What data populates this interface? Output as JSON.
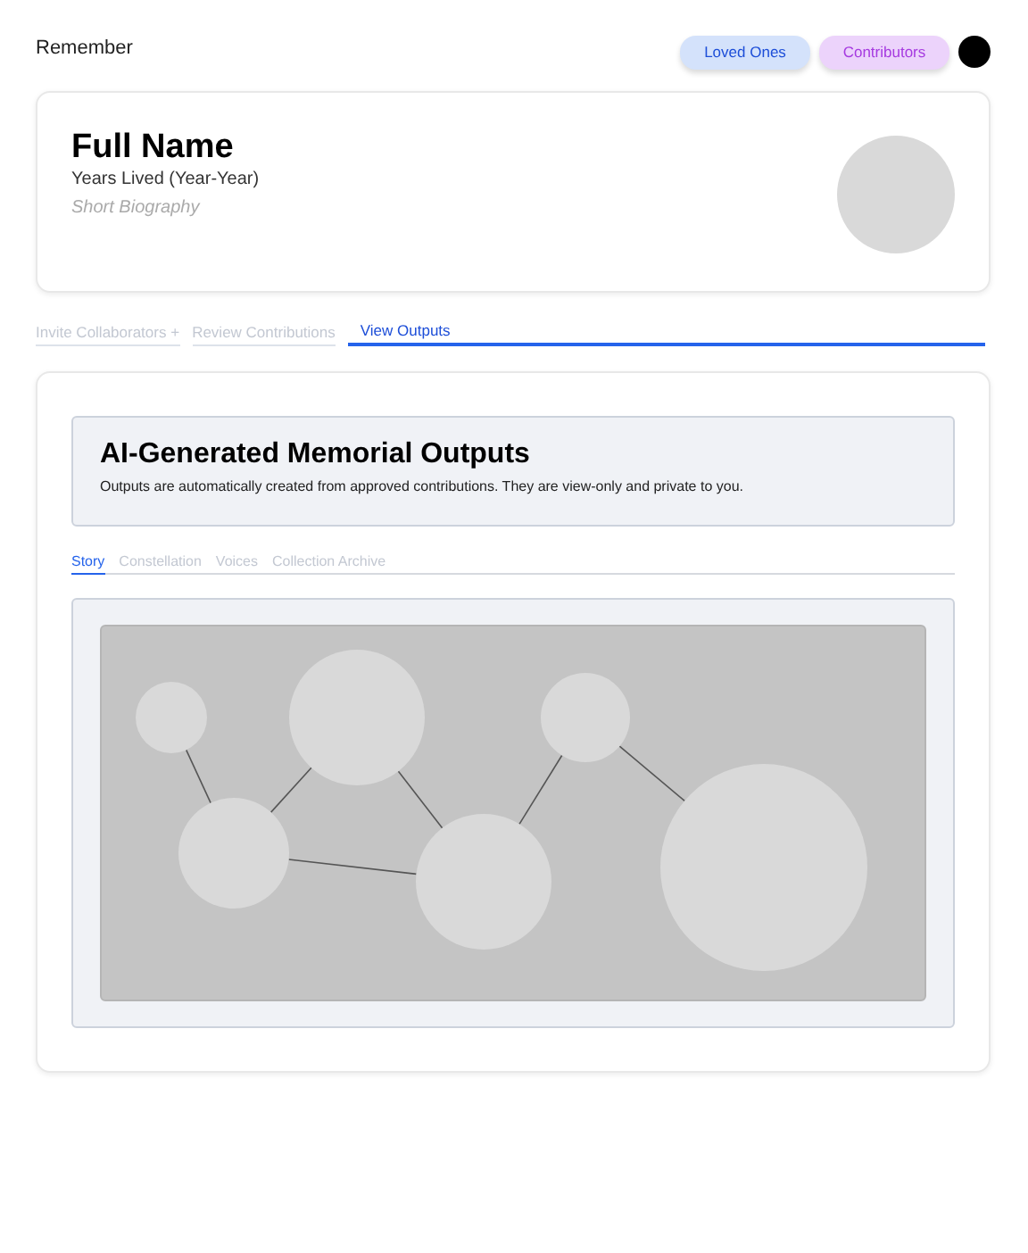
{
  "header": {
    "brand": "Remember",
    "buttons": [
      {
        "label": "Loved Ones",
        "kind": "blue"
      },
      {
        "label": "Contributors",
        "kind": "purple"
      }
    ]
  },
  "profile": {
    "name": "Full Name",
    "years": "Years Lived (Year-Year)",
    "bio": "Short Biography"
  },
  "tabs": [
    {
      "label": "Invite Collaborators +",
      "selected": false
    },
    {
      "label": "Review Contributions",
      "selected": false
    },
    {
      "label": "View Outputs",
      "selected": true
    }
  ],
  "outputs": {
    "title": "AI-Generated Memorial Outputs",
    "description": "Outputs are automatically created from approved contributions. They are view-only and private to you.",
    "tabs": [
      {
        "label": "Story",
        "selected": true
      },
      {
        "label": "Constellation",
        "selected": false
      },
      {
        "label": "Voices",
        "selected": false
      },
      {
        "label": "Collection Archive",
        "selected": false
      }
    ]
  }
}
